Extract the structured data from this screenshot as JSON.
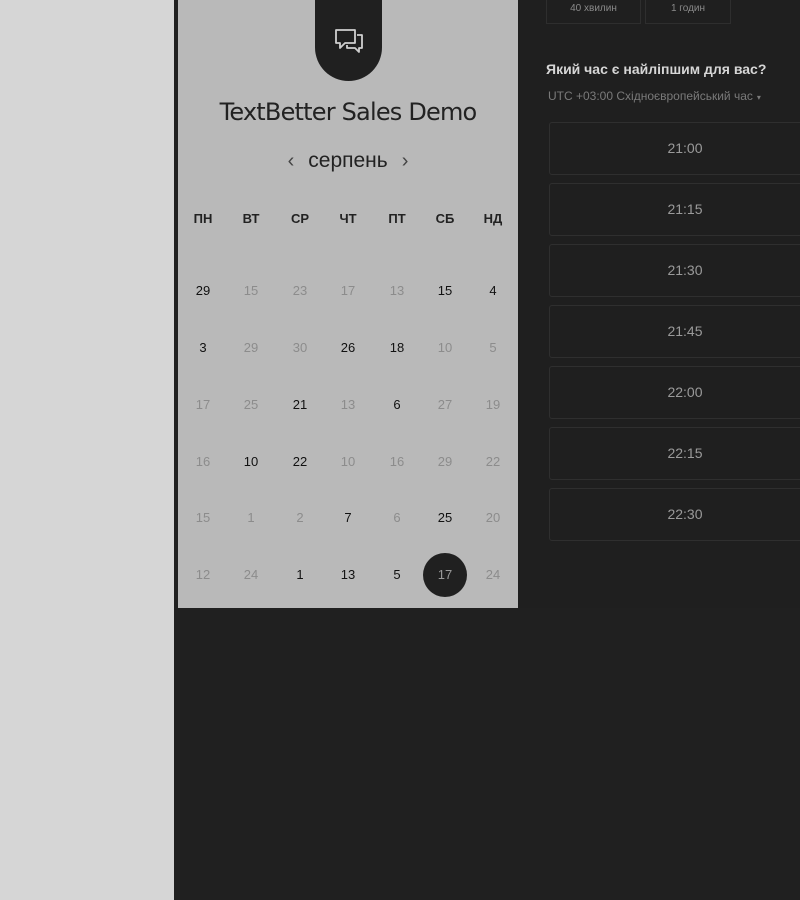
{
  "event": {
    "title": "TextBetter Sales Demo"
  },
  "logo_icon": "chat-bubbles-icon",
  "calendar": {
    "month": "серпень",
    "prev_icon": "‹",
    "next_icon": "›",
    "weekdays": [
      "ПН",
      "ВТ",
      "СР",
      "ЧТ",
      "ПТ",
      "СБ",
      "НД"
    ],
    "rows": [
      [
        {
          "n": "29",
          "s": "a"
        },
        {
          "n": "15",
          "s": "d"
        },
        {
          "n": "23",
          "s": "d"
        },
        {
          "n": "17",
          "s": "d"
        },
        {
          "n": "13",
          "s": "d"
        },
        {
          "n": "15",
          "s": "a"
        },
        {
          "n": "4",
          "s": "a"
        }
      ],
      [
        {
          "n": "3",
          "s": "a"
        },
        {
          "n": "29",
          "s": "d"
        },
        {
          "n": "30",
          "s": "d"
        },
        {
          "n": "26",
          "s": "a"
        },
        {
          "n": "18",
          "s": "a"
        },
        {
          "n": "10",
          "s": "d"
        },
        {
          "n": "5",
          "s": "d"
        }
      ],
      [
        {
          "n": "17",
          "s": "d"
        },
        {
          "n": "25",
          "s": "d"
        },
        {
          "n": "21",
          "s": "a"
        },
        {
          "n": "13",
          "s": "d"
        },
        {
          "n": "6",
          "s": "a"
        },
        {
          "n": "27",
          "s": "d"
        },
        {
          "n": "19",
          "s": "d"
        }
      ],
      [
        {
          "n": "16",
          "s": "d"
        },
        {
          "n": "10",
          "s": "a"
        },
        {
          "n": "22",
          "s": "a"
        },
        {
          "n": "10",
          "s": "d"
        },
        {
          "n": "16",
          "s": "d"
        },
        {
          "n": "29",
          "s": "d"
        },
        {
          "n": "22",
          "s": "d"
        }
      ],
      [
        {
          "n": "15",
          "s": "d"
        },
        {
          "n": "1",
          "s": "d"
        },
        {
          "n": "2",
          "s": "d"
        },
        {
          "n": "7",
          "s": "a"
        },
        {
          "n": "6",
          "s": "d"
        },
        {
          "n": "25",
          "s": "a"
        },
        {
          "n": "20",
          "s": "d"
        }
      ],
      [
        {
          "n": "12",
          "s": "d"
        },
        {
          "n": "24",
          "s": "d"
        },
        {
          "n": "1",
          "s": "a"
        },
        {
          "n": "13",
          "s": "a"
        },
        {
          "n": "5",
          "s": "a"
        },
        {
          "n": "17",
          "s": "sel"
        },
        {
          "n": "24",
          "s": "d"
        }
      ]
    ]
  },
  "durations": [
    "40 хвилин",
    "1 годин"
  ],
  "times_panel": {
    "question": "Який час є найліпшим для вас?",
    "timezone": "UTC +03:00 Східноєвропейський час",
    "timezone_caret": "▾",
    "slots": [
      "21:00",
      "21:15",
      "21:30",
      "21:45",
      "22:00",
      "22:15",
      "22:30"
    ]
  }
}
